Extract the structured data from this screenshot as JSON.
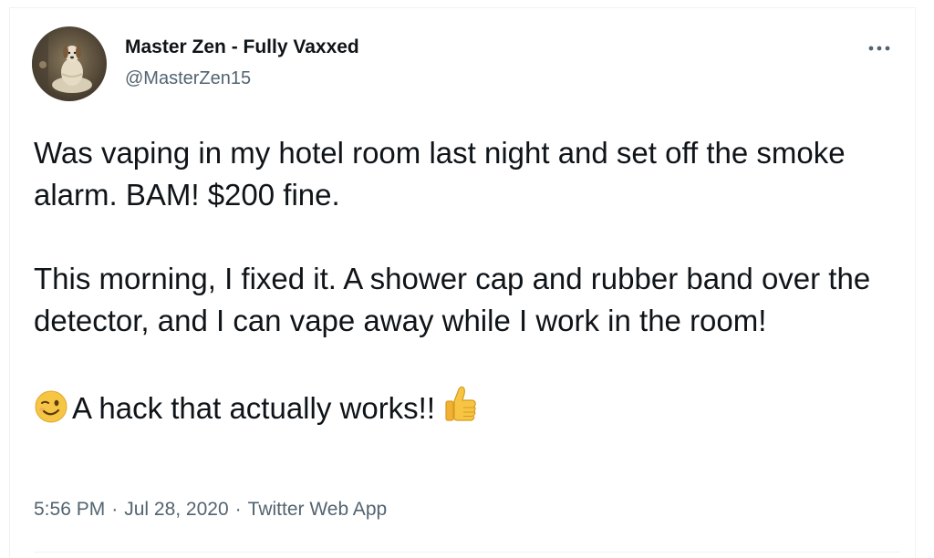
{
  "author": {
    "display_name": "Master Zen - Fully Vaxxed",
    "handle": "@MasterZen15",
    "avatar_icon": "meditating-dog-avatar"
  },
  "tweet": {
    "paragraphs": [
      "Was vaping in my hotel room last night and set off the smoke alarm. BAM! $200 fine.",
      "This morning, I fixed it. A shower cap and rubber band over the detector, and I can vape away while I work in the room!",
      "A hack that actually works!!"
    ],
    "leading_emoji": "winking-face-icon",
    "trailing_emoji": "thumbs-up-icon"
  },
  "meta": {
    "time": "5:56 PM",
    "date": "Jul 28, 2020",
    "source": "Twitter Web App",
    "separator": "·"
  },
  "colors": {
    "text_primary": "#0f1419",
    "text_secondary": "#536471",
    "border": "#eff3f4"
  }
}
